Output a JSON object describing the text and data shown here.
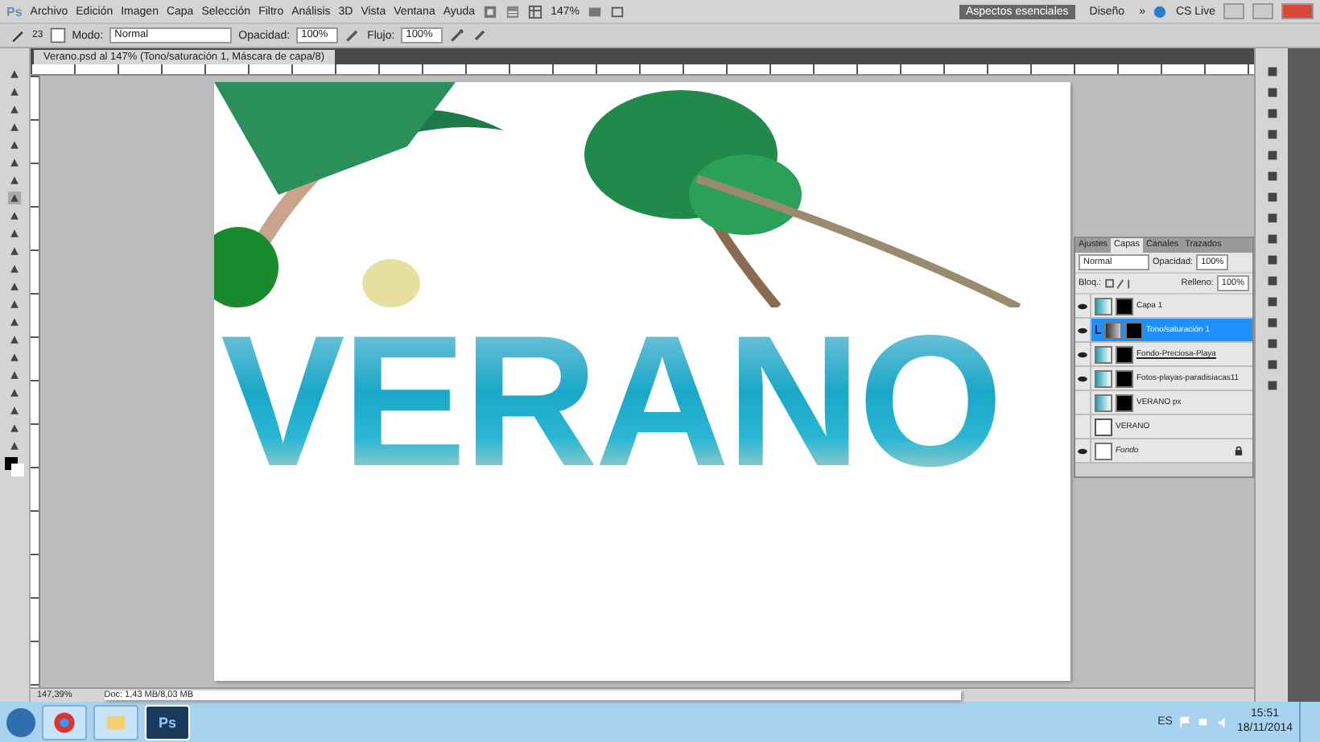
{
  "menubar": {
    "logo": "Ps",
    "items": [
      "Archivo",
      "Edición",
      "Imagen",
      "Capa",
      "Selección",
      "Filtro",
      "Análisis",
      "3D",
      "Vista",
      "Ventana",
      "Ayuda"
    ],
    "zoom": "147%",
    "workspaces": [
      {
        "label": "Aspectos esenciales",
        "selected": true
      },
      {
        "label": "Diseño",
        "selected": false
      }
    ],
    "more": "»",
    "cs_live": "CS Live"
  },
  "options": {
    "brush_size": "23",
    "mode_label": "Modo:",
    "mode": "Normal",
    "opacity_label": "Opacidad:",
    "opacity": "100%",
    "flow_label": "Flujo:",
    "flow": "100%"
  },
  "document": {
    "tab": "Verano.psd al 147% (Tono/saturación 1, Máscara de capa/8)",
    "artwork_text": "VERANO",
    "zoom": "147,39%",
    "doc_size": "Doc: 1,43 MB/8,03 MB"
  },
  "layers_panel": {
    "tabs": [
      {
        "label": "Ajustes",
        "selected": false
      },
      {
        "label": "Capas",
        "selected": true
      },
      {
        "label": "Canales",
        "selected": false
      },
      {
        "label": "Trazados",
        "selected": false
      }
    ],
    "blend": "Normal",
    "opacity_label": "Opacidad:",
    "opacity": "100%",
    "lock_label": "Bloq.:",
    "fill_label": "Relleno:",
    "fill": "100%",
    "layers": [
      {
        "name": "Capa 1",
        "kind": "pixel",
        "visible": true,
        "selected": false,
        "mask": true,
        "clipped": false,
        "clip_base": false
      },
      {
        "name": "Tono/saturación 1",
        "kind": "adjustment",
        "visible": true,
        "selected": true,
        "mask": true,
        "clipped": true,
        "clip_base": false
      },
      {
        "name": "Fondo-Preciosa-Playa",
        "kind": "pixel",
        "visible": true,
        "selected": false,
        "mask": true,
        "clipped": false,
        "clip_base": true
      },
      {
        "name": "Fotos-playas-paradisiacas11",
        "kind": "pixel",
        "visible": true,
        "selected": false,
        "mask": true,
        "clipped": false,
        "clip_base": false
      },
      {
        "name": "VERANO px",
        "kind": "pixel",
        "visible": false,
        "selected": false,
        "mask": true,
        "clipped": false,
        "clip_base": false
      },
      {
        "name": "VERANO",
        "kind": "text",
        "visible": false,
        "selected": false,
        "mask": false,
        "clipped": false,
        "clip_base": false
      },
      {
        "name": "Fondo",
        "kind": "background",
        "visible": true,
        "selected": false,
        "mask": false,
        "clipped": false,
        "clip_base": false
      }
    ]
  },
  "taskbar": {
    "language": "ES",
    "time": "15:51",
    "date": "18/11/2014",
    "apps": [
      {
        "label": "Ps",
        "selected": true
      }
    ]
  }
}
